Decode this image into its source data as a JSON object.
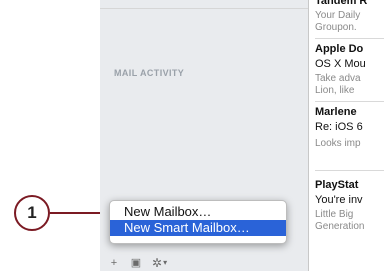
{
  "callout": {
    "number": "1"
  },
  "sidebar": {
    "section_header": "MAIL ACTIVITY",
    "bottom_bar": {
      "add_label": "+",
      "mailbox_label": "▣",
      "gear_label": "✲",
      "gear_chevron": "▾"
    }
  },
  "context_menu": {
    "items": [
      {
        "label": "New Mailbox…",
        "selected": false
      },
      {
        "label": "New Smart Mailbox…",
        "selected": true
      }
    ]
  },
  "message_list": {
    "messages": [
      {
        "from": "Tandem R",
        "preview_lines": [
          "Your Daily",
          "Groupon."
        ]
      },
      {
        "from": "Apple Do",
        "subject": "OS X Mou",
        "preview_lines": [
          "Take adva",
          "Lion, like"
        ]
      },
      {
        "from": "Marlene",
        "subject": "Re: iOS 6",
        "preview_lines": [
          "Looks imp"
        ]
      },
      {
        "from": "PlayStat",
        "subject": "You're inv",
        "preview_lines": [
          "Little Big",
          "Generation"
        ]
      }
    ]
  },
  "colors": {
    "callout": "#7b1a23",
    "menu_selected": "#2a63d8"
  }
}
